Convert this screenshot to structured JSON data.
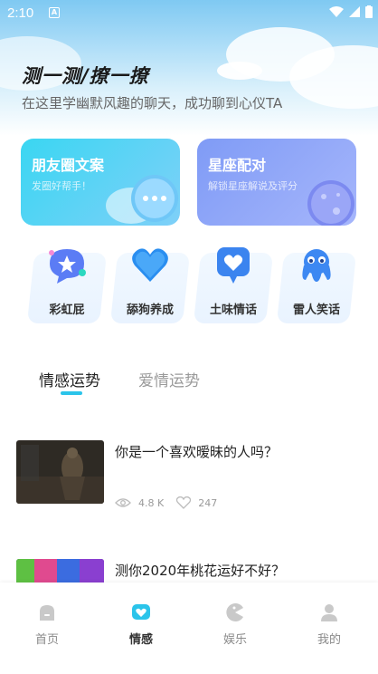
{
  "status_bar": {
    "time": "2:10",
    "notif_glyph": "A"
  },
  "hero": {
    "title": "测一测/撩一撩",
    "subtitle": "在这里学幽默风趣的聊天，成功聊到心仪TA"
  },
  "feature_cards": [
    {
      "title": "朋友圈文案",
      "subtitle": "发圈好帮手！",
      "icon": "chat-bubble-icon"
    },
    {
      "title": "星座配对",
      "subtitle": "解锁星座解说及评分",
      "icon": "planet-icon"
    }
  ],
  "tiles": [
    {
      "label": "彩虹屁",
      "icon": "star-chat-icon"
    },
    {
      "label": "舔狗养成",
      "icon": "heart-icon"
    },
    {
      "label": "土味情话",
      "icon": "heart-message-icon"
    },
    {
      "label": "雷人笑话",
      "icon": "octopus-icon"
    }
  ],
  "tabs": [
    {
      "label": "情感运势",
      "active": true
    },
    {
      "label": "爱情运势",
      "active": false
    }
  ],
  "articles": [
    {
      "question": "你是一个喜欢暧昧的人吗？",
      "views": "4.8 K",
      "likes": "247"
    },
    {
      "question": "测你2020年桃花运好不好？"
    }
  ],
  "bottom_nav": [
    {
      "label": "首页",
      "icon": "home-icon",
      "active": false
    },
    {
      "label": "情感",
      "icon": "heart-icon",
      "active": true
    },
    {
      "label": "娱乐",
      "icon": "pacman-icon",
      "active": false
    },
    {
      "label": "我的",
      "icon": "user-icon",
      "active": false
    }
  ],
  "colors": {
    "accent": "#2bc4ea",
    "card1": "#3ad6f2",
    "card2": "#7f9bf6"
  }
}
